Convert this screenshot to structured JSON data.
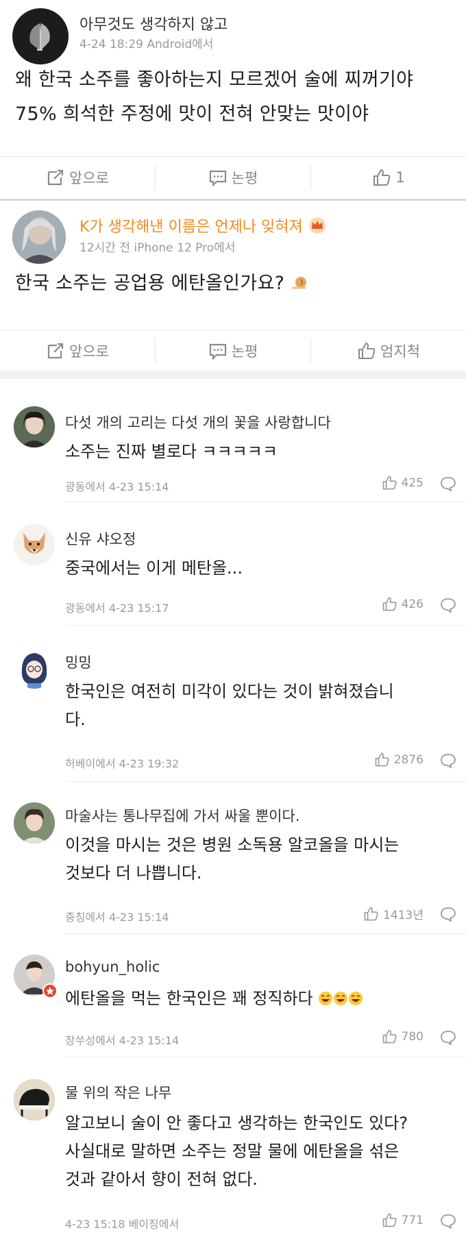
{
  "post1": {
    "username": "아무것도 생각하지 않고",
    "meta": "4-24 18:29 Android에서",
    "text_line1": "왜 한국 소주를 좋아하는지 모르겠어 술에 찌꺼기야",
    "text_line2": "75% 희석한 주정에 맛이 전혀 안맞는 맛이야",
    "actions": {
      "forward": "앞으로",
      "comment": "논평",
      "like": "1"
    }
  },
  "post2": {
    "username": "K가 생각해낸 이름은 언제나 잊혀져",
    "meta": "12시간 전 iPhone 12 Pro에서",
    "text": "한국 소주는 공업용 에탄올인가요?",
    "actions": {
      "forward": "앞으로",
      "comment": "논평",
      "like": "엄지척"
    }
  },
  "comments": [
    {
      "username": "다섯 개의 고리는 다섯 개의 꽃을 사랑합니다",
      "line1": "소주는 진짜 별로다 ㅋㅋㅋㅋㅋ",
      "line2": "",
      "meta": "광동에서 4-23 15:14",
      "likes": "425"
    },
    {
      "username": "신유 샤오정",
      "line1": "중국에서는 이게 메탄올...",
      "line2": "",
      "meta": "광동에서 4-23 15:17",
      "likes": "426"
    },
    {
      "username": "밍밍",
      "line1": "한국인은 여전히 미각이 있다는 것이 밝혀졌습니",
      "line2": "다.",
      "meta": "허베이에서 4-23 19:32",
      "likes": "2876"
    },
    {
      "username": "마술사는 통나무집에 가서 싸울 뿐이다.",
      "line1": "이것을 마시는 것은 병원 소독용 알코올을 마시는",
      "line2": "것보다 더 나쁩니다.",
      "meta": "충칭에서 4-23 15:14",
      "likes": "1413년"
    },
    {
      "username": "bohyun_holic",
      "line1": "에탄올을 먹는 한국인은 꽤 정직하다",
      "line2": "",
      "meta": "장쑤성에서 4-23 15:14",
      "likes": "780"
    },
    {
      "username": "물 위의 작은 나무",
      "line1": "알고보니 술이 안 좋다고 생각하는 한국인도 있다?",
      "line2": "사실대로 말하면 소주는 정말 물에 에탄올을 섞은",
      "line3": "것과 같아서 향이 전혀 없다.",
      "meta": "4-23 15:18 베이징에서",
      "likes": "771"
    }
  ],
  "colors": {
    "vip_username": "#f08a1c",
    "meta": "#9a9a9a",
    "text": "#1e1e1e"
  },
  "icons": [
    "forward-icon",
    "comment-icon",
    "thumbs-up-icon",
    "reply-bubble-icon",
    "crown-badge-icon",
    "laughing-emoji-icon",
    "snail-emoji-icon"
  ]
}
